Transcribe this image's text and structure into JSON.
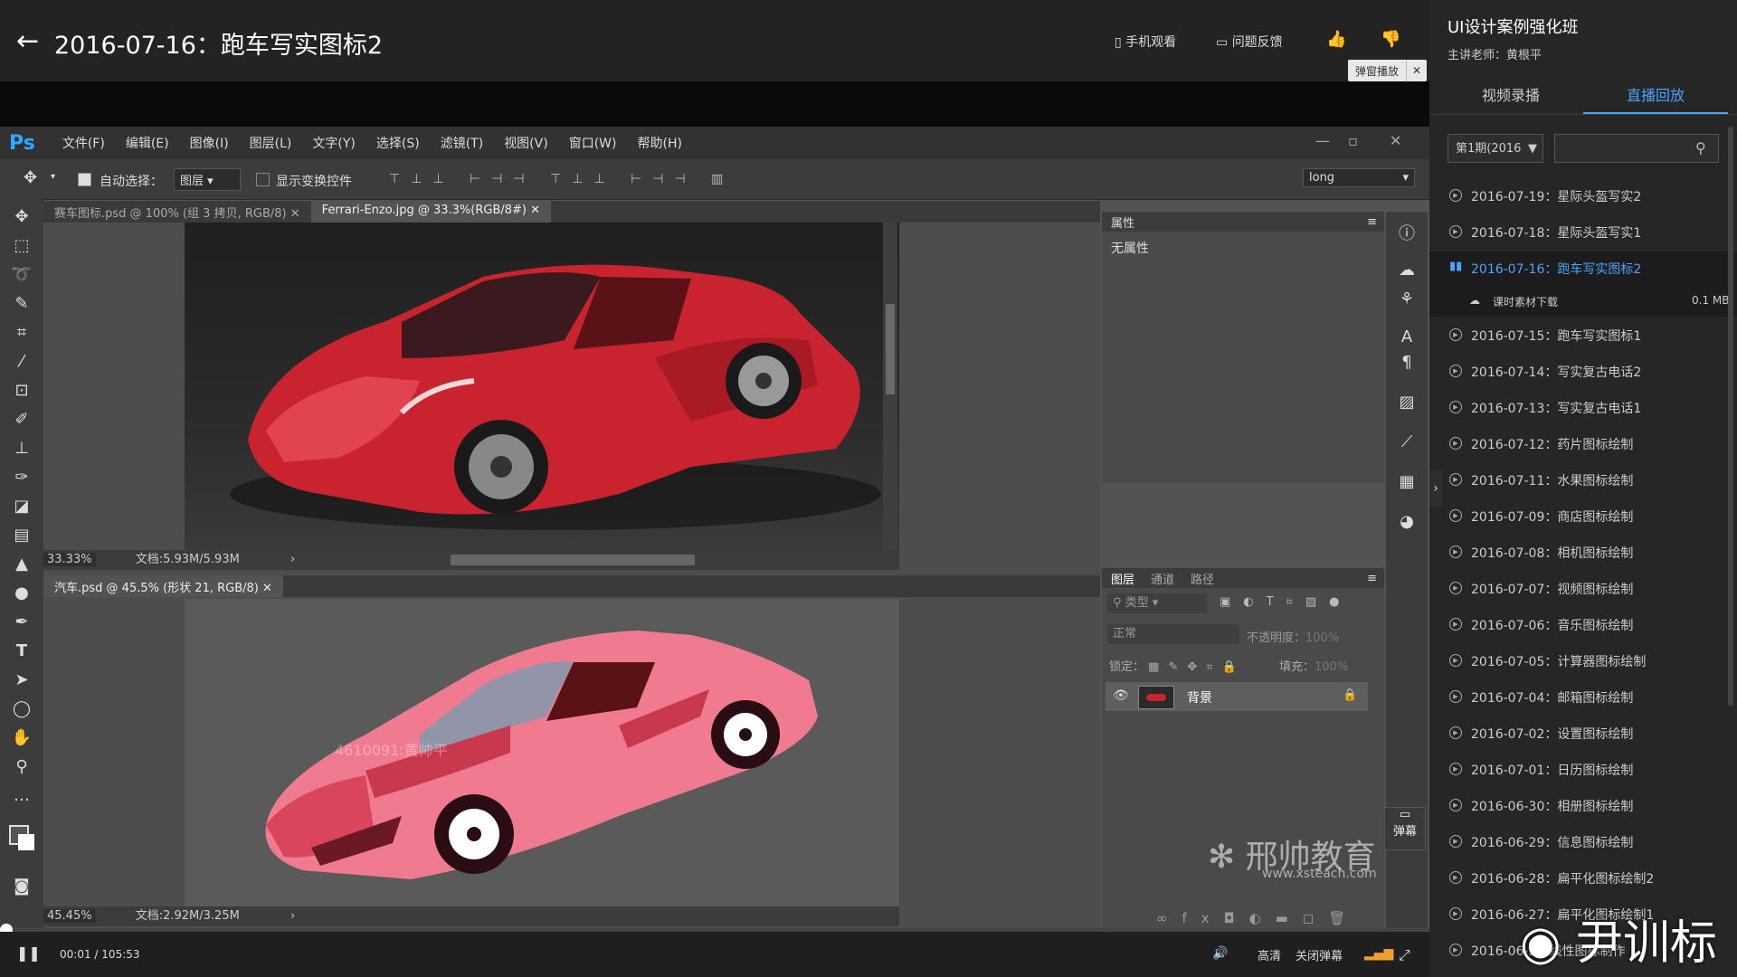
{
  "header": {
    "back_icon": "←",
    "title": "2016-07-16：跑车写实图标2",
    "mobile_label": "手机观看",
    "feedback_label": "问题反馈",
    "danmu_tip": "弹窗播放",
    "close_icon": "✕"
  },
  "ps": {
    "logo": "Ps",
    "menu": [
      "文件(F)",
      "编辑(E)",
      "图像(I)",
      "图层(L)",
      "文字(Y)",
      "选择(S)",
      "滤镜(T)",
      "视图(V)",
      "窗口(W)",
      "帮助(H)"
    ],
    "options": {
      "auto_select": "自动选择：",
      "layer_dd": "图层",
      "show_transform": "显示变换控件",
      "workspace": "long"
    },
    "doc1_tabs": [
      "赛车图标.psd @ 100% (组 3 拷贝, RGB/8)",
      "Ferrari-Enzo.jpg @ 33.3%(RGB/8#)"
    ],
    "doc1_status": {
      "zoom": "33.33%",
      "doc": "文档:5.93M/5.93M"
    },
    "doc2_tab": "汽车.psd @ 45.5% (形状 21, RGB/8)",
    "doc2_status": {
      "zoom": "45.45%",
      "doc": "文档:2.92M/3.25M"
    },
    "canvas_watermark": "4610091:黄帅平",
    "properties": {
      "title": "属性",
      "content": "无属性"
    },
    "layers_panel": {
      "tabs": [
        "图层",
        "通道",
        "路径"
      ],
      "kind": "类型",
      "blend": "正常",
      "opacity_label": "不透明度：",
      "opacity": "100%",
      "lock_label": "锁定：",
      "fill_label": "填充：",
      "fill": "100%",
      "layer_name": "背景"
    }
  },
  "player": {
    "time_current": "00:01",
    "time_sep": "/",
    "time_total": "105:53",
    "quality": "高清",
    "danmu_toggle": "关闭弹幕",
    "danmu_side": "弹幕",
    "progress": 0.0002
  },
  "sidebar": {
    "course_title": "UI设计案例强化班",
    "teacher": "主讲老师：黄根平",
    "tabs": [
      "视频录播",
      "直播回放"
    ],
    "period": "第1期(2016",
    "download_label": "课时素材下载",
    "download_size": "0.1 MB",
    "episodes": [
      "2016-07-19：星际头盔写实2",
      "2016-07-18：星际头盔写实1",
      "2016-07-16：跑车写实图标2",
      "2016-07-15：跑车写实图标1",
      "2016-07-14：写实复古电话2",
      "2016-07-13：写实复古电话1",
      "2016-07-12：药片图标绘制",
      "2016-07-11：水果图标绘制",
      "2016-07-09：商店图标绘制",
      "2016-07-08：相机图标绘制",
      "2016-07-07：视频图标绘制",
      "2016-07-06：音乐图标绘制",
      "2016-07-05：计算器图标绘制",
      "2016-07-04：邮箱图标绘制",
      "2016-07-02：设置图标绘制",
      "2016-07-01：日历图标绘制",
      "2016-06-30：相册图标绘制",
      "2016-06-29：信息图标绘制",
      "2016-06-28：扁平化图标绘制2",
      "2016-06-27：扁平化图标绘制1",
      "2016-06-2：线性图标制作"
    ]
  },
  "watermarks": {
    "brand": "邢帅教育",
    "brand_url": "www.xsteach.com",
    "weibo": "尹训标"
  },
  "colors": {
    "accent": "#4aa3ff",
    "ps_blue": "#31a8ff",
    "car_red": "#c8232f",
    "car_pink": "#f07b91"
  }
}
